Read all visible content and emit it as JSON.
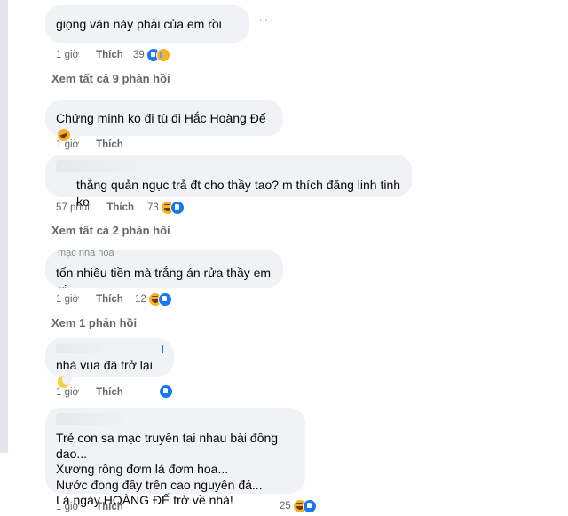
{
  "comments": [
    {
      "text": "giọng văn này   phải của em      rồi",
      "time": "1 giờ",
      "like": "Thích",
      "count": "39"
    },
    {
      "text": "Chứng minh ko đi tù đi Hắc Hoàng Đế",
      "time": "1 giờ",
      "like": "Thích"
    },
    {
      "text": "thằng quản ngục trả đt cho thầy tao? m thích đăng linh tinh ko",
      "time": "57 phút",
      "like": "Thích",
      "count": "73"
    },
    {
      "text": "tốn nhiêu tiền mà trắng án rửa thầy em ơi",
      "time": "1 giờ",
      "like": "Thích",
      "count": "12"
    },
    {
      "text": "nhà vua đã trở lại",
      "time": "1 giờ",
      "like": "Thích"
    },
    {
      "lines": [
        "Trẻ con sa mạc truyền tai nhau bài đồng dao...",
        "Xương rồng đơm lá đơm hoa...",
        "Nước đong đầy trên cao nguyên đá...",
        "Là ngày HOÀNG ĐẾ trở về nhà!"
      ],
      "time": "1 giờ",
      "like": "Thích",
      "count": "25"
    }
  ],
  "replies": {
    "r1": "Xem tất cả 9 phản hồi",
    "r2": "Xem tất cả 2 phản hồi",
    "r3": "Xem 1 phản hồi"
  },
  "partial_author": "mạc nhà hoa",
  "colors": {
    "bubble": "#f0f2f5",
    "meta": "#65676b",
    "like_blue": "#1877f2",
    "haha_yellow": "#f7b125"
  }
}
